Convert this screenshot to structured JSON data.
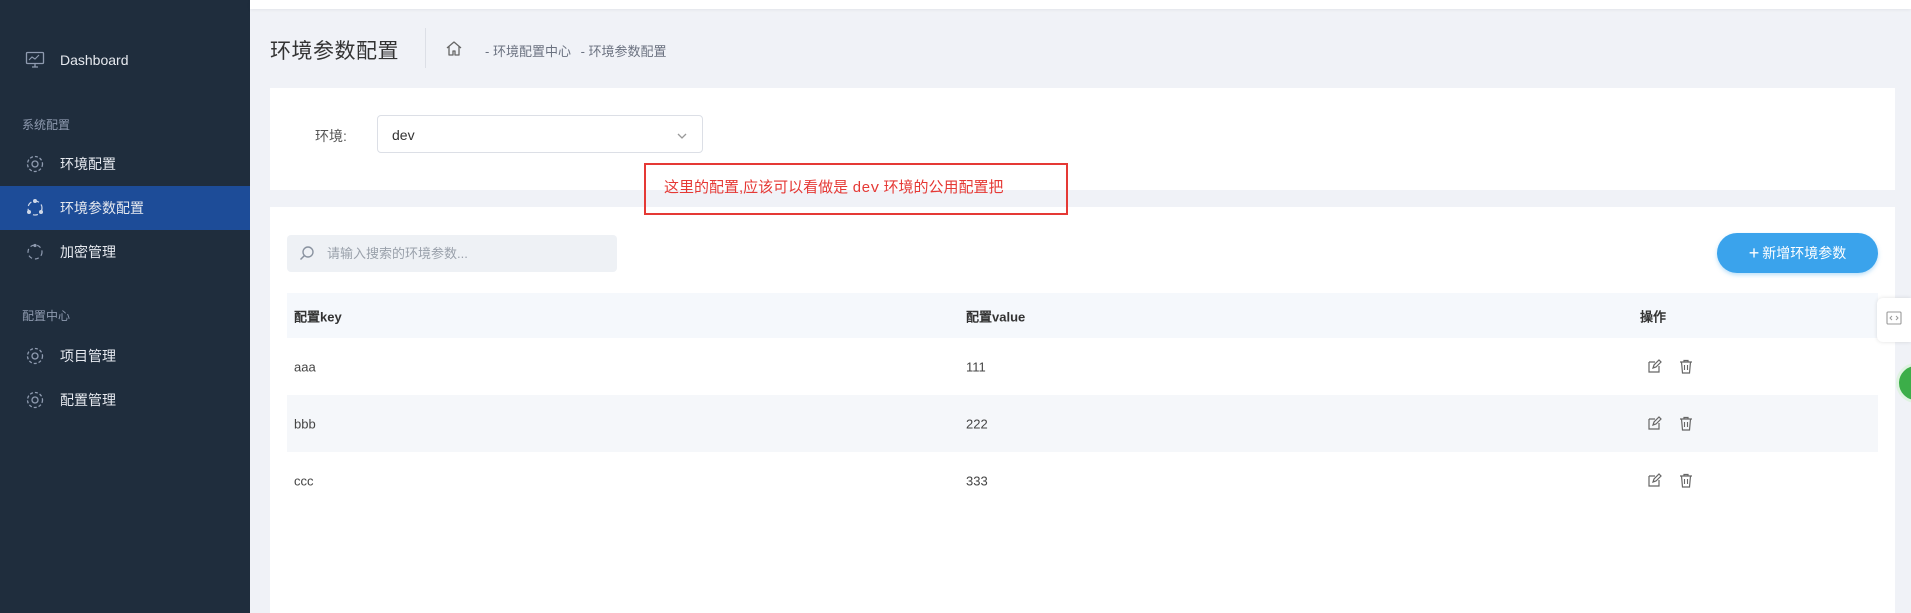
{
  "sidebar": {
    "items": [
      {
        "label": "Dashboard",
        "icon": "monitor-icon"
      },
      {
        "label": "环境配置",
        "icon": "gear-icon"
      },
      {
        "label": "环境参数配置",
        "icon": "share-icon",
        "active": true
      },
      {
        "label": "加密管理",
        "icon": "lock-icon"
      },
      {
        "label": "项目管理",
        "icon": "gear-icon"
      },
      {
        "label": "配置管理",
        "icon": "gear-icon"
      }
    ],
    "groups": [
      "系统配置",
      "配置中心"
    ]
  },
  "header": {
    "title": "环境参数配置",
    "breadcrumb": [
      "- 环境配置中心",
      "- 环境参数配置"
    ]
  },
  "filter": {
    "env_label": "环境:",
    "env_value": "dev"
  },
  "annotation": {
    "text_before": "这里的配置,应该可以看做是 ",
    "code": "dev",
    "text_after": " 环境的公用配置把",
    "color": "#e53935"
  },
  "search": {
    "placeholder": "请输入搜索的环境参数..."
  },
  "add_button": {
    "label": "新增环境参数",
    "color": "#3aa3ec"
  },
  "table": {
    "columns": [
      "配置key",
      "配置value",
      "操作"
    ],
    "rows": [
      {
        "key": "aaa",
        "value": "111"
      },
      {
        "key": "bbb",
        "value": "222"
      },
      {
        "key": "ccc",
        "value": "333"
      }
    ]
  },
  "colors": {
    "sidebar_bg": "#1f2d3d",
    "sidebar_active": "#1d4c98",
    "page_bg": "#f0f2f7"
  }
}
